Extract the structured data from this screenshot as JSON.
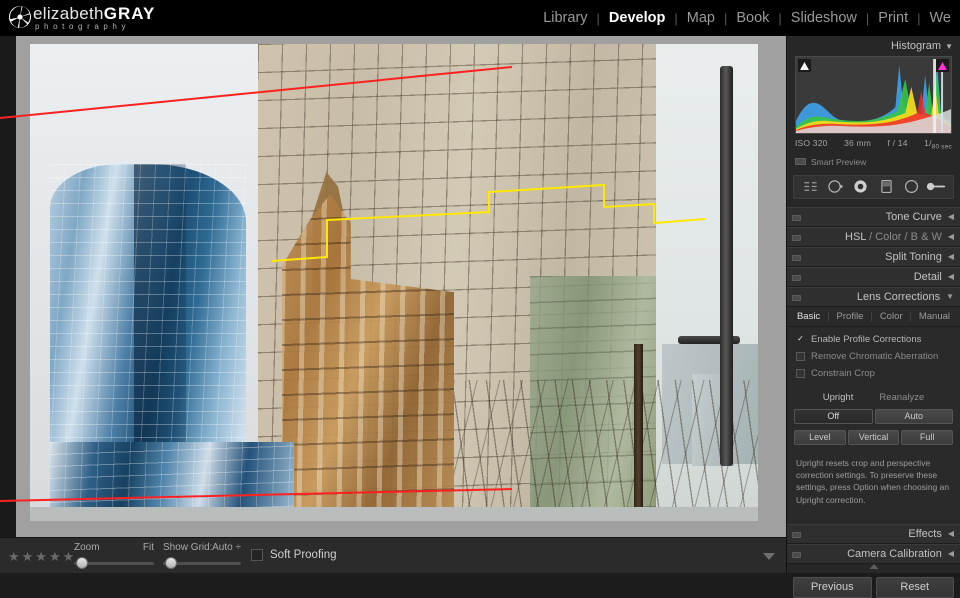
{
  "app": {
    "logo_name": "elizabeth",
    "logo_bold": "GRAY",
    "logo_sub": "photography"
  },
  "modules": [
    {
      "label": "Library",
      "active": false
    },
    {
      "label": "Develop",
      "active": true
    },
    {
      "label": "Map",
      "active": false
    },
    {
      "label": "Book",
      "active": false
    },
    {
      "label": "Slideshow",
      "active": false
    },
    {
      "label": "Print",
      "active": false
    },
    {
      "label": "We",
      "active": false
    }
  ],
  "histogram": {
    "title": "Histogram",
    "arrow": "▼",
    "metadata": {
      "iso": "ISO 320",
      "focal": "36 mm",
      "aperture": "f / 14",
      "shutter_num": "1",
      "shutter_den": "80 sec"
    },
    "smart_preview": "Smart Preview"
  },
  "tools": [
    {
      "name": "crop-overlay-tool"
    },
    {
      "name": "spot-removal-tool"
    },
    {
      "name": "red-eye-correction-tool"
    },
    {
      "name": "graduated-filter-tool"
    },
    {
      "name": "radial-filter-tool"
    },
    {
      "name": "adjustment-brush-tool"
    }
  ],
  "panels": [
    {
      "title": "Tone Curve",
      "arrow": "◀",
      "expanded": false
    },
    {
      "title": "HSL / Color / B & W",
      "arrow": "◀",
      "expanded": false
    },
    {
      "title": "Split Toning",
      "arrow": "◀",
      "expanded": false
    },
    {
      "title": "Detail",
      "arrow": "◀",
      "expanded": false
    },
    {
      "title": "Lens Corrections",
      "arrow": "▼",
      "expanded": true
    },
    {
      "title": "Effects",
      "arrow": "◀",
      "expanded": false
    },
    {
      "title": "Camera Calibration",
      "arrow": "◀",
      "expanded": false
    }
  ],
  "panel_titles": {
    "tone_curve": "Tone Curve",
    "hsl_hsl": "HSL",
    "hsl_color": "Color",
    "hsl_bw": "B & W",
    "hsl_sep": "/",
    "split_toning": "Split Toning",
    "detail": "Detail",
    "lens_corrections": "Lens Corrections",
    "effects": "Effects",
    "camera_calibration": "Camera Calibration"
  },
  "lens_corrections": {
    "tabs": [
      {
        "label": "Basic",
        "selected": true
      },
      {
        "label": "Profile",
        "selected": false
      },
      {
        "label": "Color",
        "selected": false
      },
      {
        "label": "Manual",
        "selected": false
      }
    ],
    "checkboxes": [
      {
        "label": "Enable Profile Corrections",
        "checked": true
      },
      {
        "label": "Remove Chromatic Aberration",
        "checked": false
      },
      {
        "label": "Constrain Crop",
        "checked": false
      }
    ],
    "upright_label": "Upright",
    "reanalyze_label": "Reanalyze",
    "mode_buttons_row1": [
      {
        "label": "Off",
        "selected": true
      },
      {
        "label": "Auto",
        "selected": false
      }
    ],
    "mode_buttons_row2": [
      {
        "label": "Level",
        "selected": false
      },
      {
        "label": "Vertical",
        "selected": false
      },
      {
        "label": "Full",
        "selected": false
      }
    ],
    "help_text": "Upright resets crop and perspective correction settings. To preserve these settings, press Option when choosing an Upright correction."
  },
  "footer_buttons": {
    "previous": "Previous",
    "reset": "Reset"
  },
  "toolbar": {
    "stars": "★★★★★",
    "zoom_label": "Zoom",
    "zoom_value": "Fit",
    "grid_label": "Show Grid:",
    "grid_value": "Auto",
    "grid_caret": "÷",
    "soft_proofing": "Soft Proofing"
  },
  "guides": {
    "line_color_horizon": "#ff2020",
    "line_color_level": "#ffe800",
    "note": "Upright guided overlay lines drawn on the photo"
  }
}
